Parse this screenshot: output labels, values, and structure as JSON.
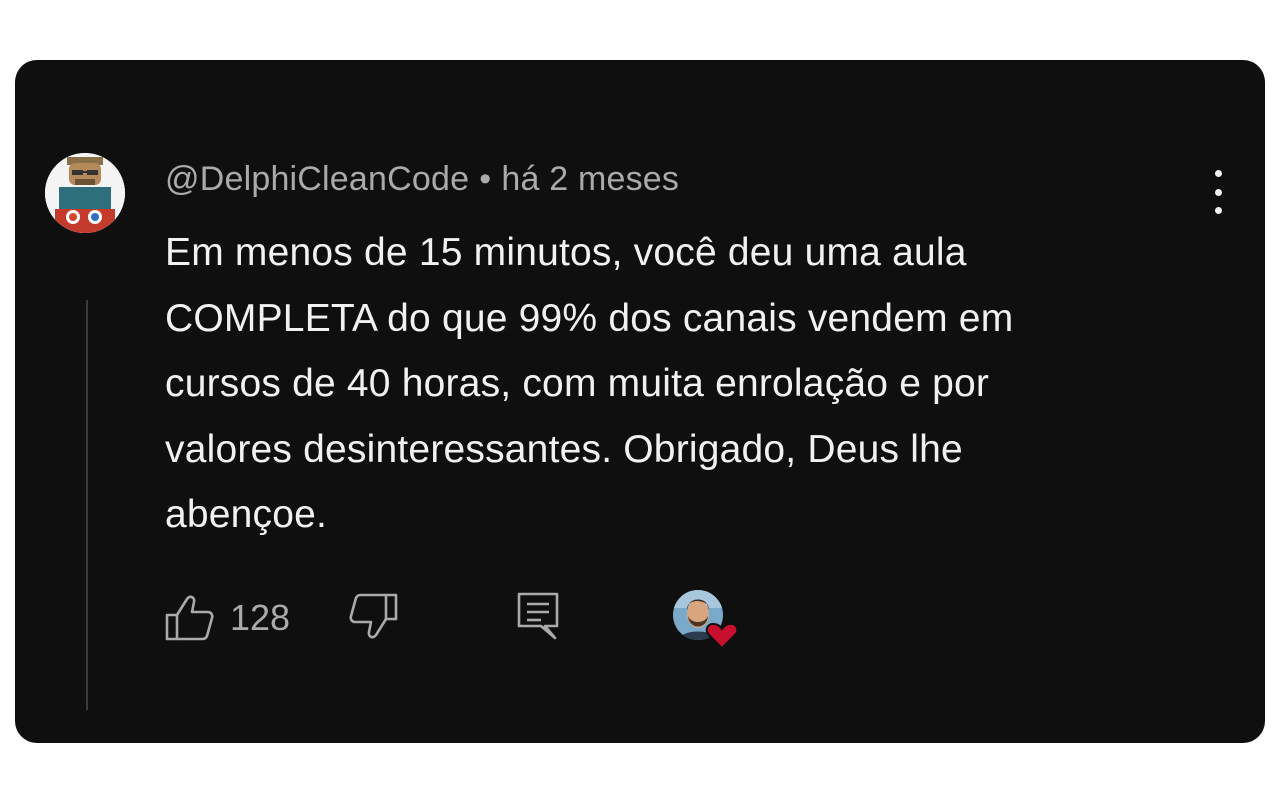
{
  "comment": {
    "author": "@DelphiCleanCode",
    "separator": "•",
    "timestamp": "há 2 meses",
    "text": "Em menos de 15 minutos, você deu uma aula\nCOMPLETA do que 99% dos canais vendem em\ncursos de 40 horas, com muita enrolação e por\nvalores desinteressantes. Obrigado, Deus lhe\nabençoe.",
    "like_count": "128"
  },
  "icons": {
    "avatar": "avatar",
    "more": "more-vert-icon",
    "like": "thumb-up-icon",
    "dislike": "thumb-down-icon",
    "reply": "comment-reply-icon",
    "creator_heart": "creator-heart-icon"
  },
  "colors": {
    "background": "#0f0f0f",
    "text_primary": "#f1f1f1",
    "text_secondary": "#aaaaaa",
    "heart": "#c8102e"
  }
}
